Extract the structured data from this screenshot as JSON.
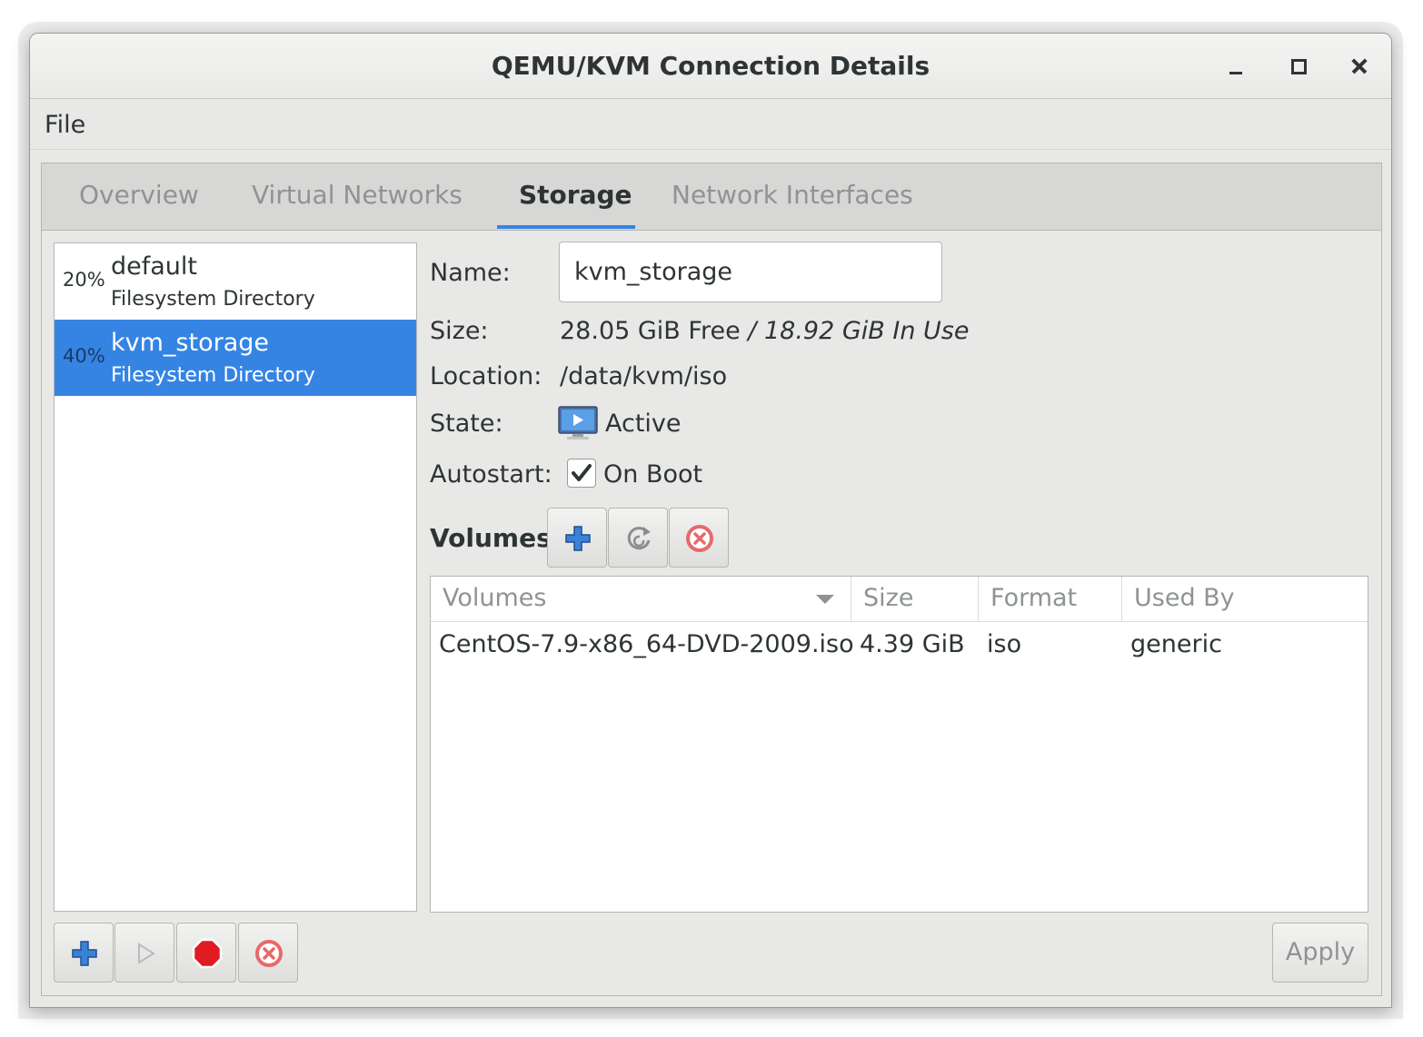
{
  "window": {
    "title": "QEMU/KVM Connection Details"
  },
  "menu": {
    "file": "File"
  },
  "tabs": [
    {
      "label": "Overview"
    },
    {
      "label": "Virtual Networks"
    },
    {
      "label": "Storage"
    },
    {
      "label": "Network Interfaces"
    }
  ],
  "active_tab": "Storage",
  "pools": [
    {
      "percent": "20%",
      "name": "default",
      "type": "Filesystem Directory",
      "selected": false
    },
    {
      "percent": "40%",
      "name": "kvm_storage",
      "type": "Filesystem Directory",
      "selected": true
    }
  ],
  "details": {
    "name_label": "Name:",
    "name_value": "kvm_storage",
    "size_label": "Size:",
    "size_free": "28.05 GiB Free",
    "size_separator": " / ",
    "size_in_use": "18.92 GiB In Use",
    "location_label": "Location:",
    "location_value": "/data/kvm/iso",
    "state_label": "State:",
    "state_value": "Active",
    "autostart_label": "Autostart:",
    "autostart_value": "On Boot",
    "autostart_checked": true
  },
  "volumes": {
    "title": "Volumes",
    "columns": [
      "Volumes",
      "Size",
      "Format",
      "Used By"
    ],
    "rows": [
      {
        "name": "CentOS-7.9-x86_64-DVD-2009.iso",
        "size": "4.39 GiB",
        "format": "iso",
        "used_by": "generic"
      }
    ]
  },
  "buttons": {
    "apply": "Apply"
  },
  "colors": {
    "selection": "#3584e4",
    "accent_blue": "#3584e4",
    "stop_red": "#e01b24"
  }
}
